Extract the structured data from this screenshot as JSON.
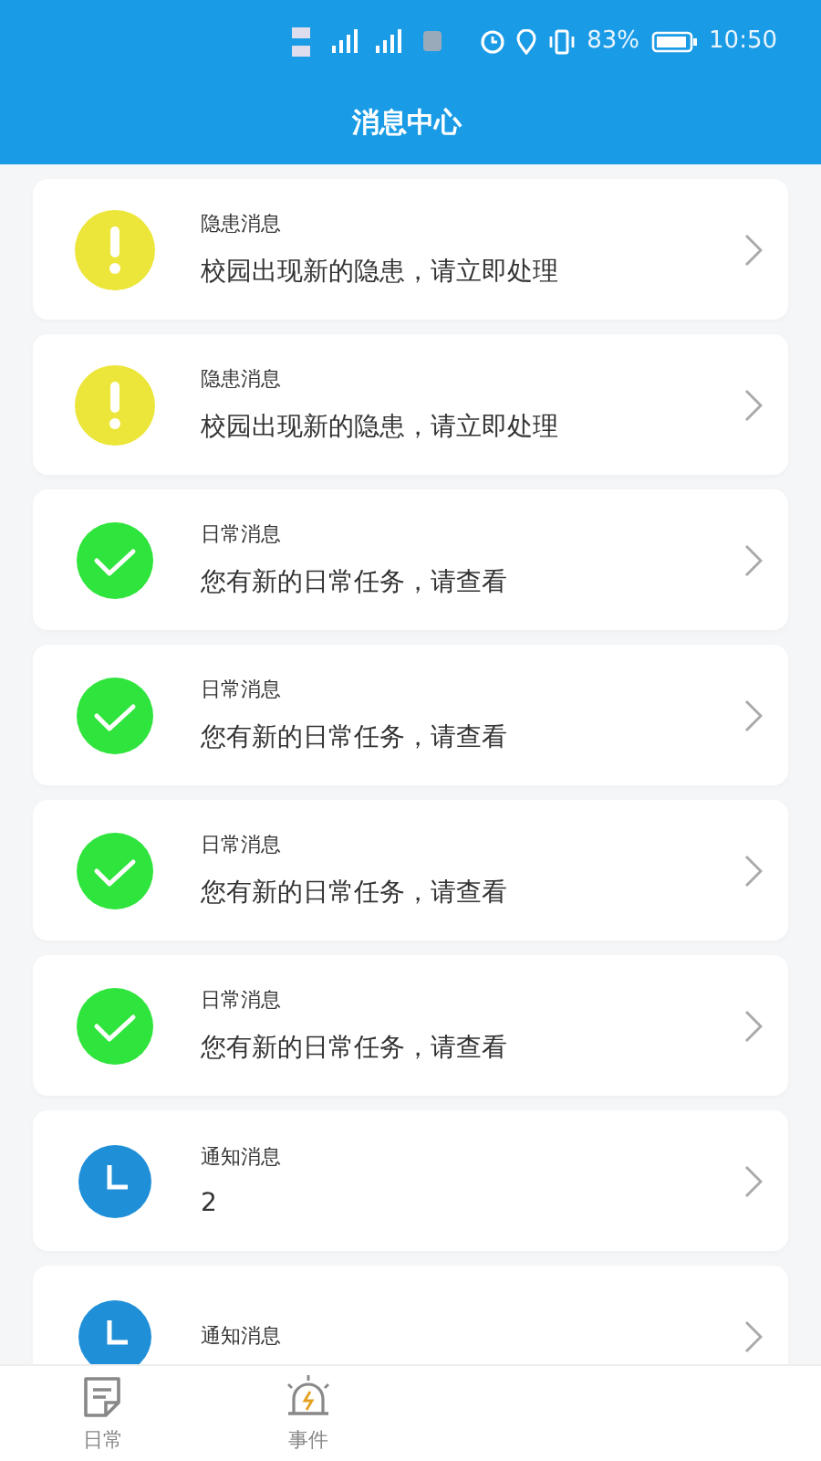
{
  "status_bar": {
    "battery": "83%",
    "time": "10:50"
  },
  "header": {
    "title": "消息中心"
  },
  "messages": [
    {
      "kind": "warning",
      "title": "隐患消息",
      "text": "校园出现新的隐患，请立即处理"
    },
    {
      "kind": "warning",
      "title": "隐患消息",
      "text": "校园出现新的隐患，请立即处理"
    },
    {
      "kind": "done",
      "title": "日常消息",
      "text": "您有新的日常任务，请查看"
    },
    {
      "kind": "done",
      "title": "日常消息",
      "text": "您有新的日常任务，请查看"
    },
    {
      "kind": "done",
      "title": "日常消息",
      "text": "您有新的日常任务，请查看"
    },
    {
      "kind": "done",
      "title": "日常消息",
      "text": "您有新的日常任务，请查看"
    },
    {
      "kind": "notice",
      "title": "通知消息",
      "text": "2"
    },
    {
      "kind": "notice",
      "title": "通知消息"
    }
  ],
  "nav": [
    {
      "kind": "daily",
      "label": "日常"
    },
    {
      "kind": "event",
      "label": "事件"
    }
  ]
}
